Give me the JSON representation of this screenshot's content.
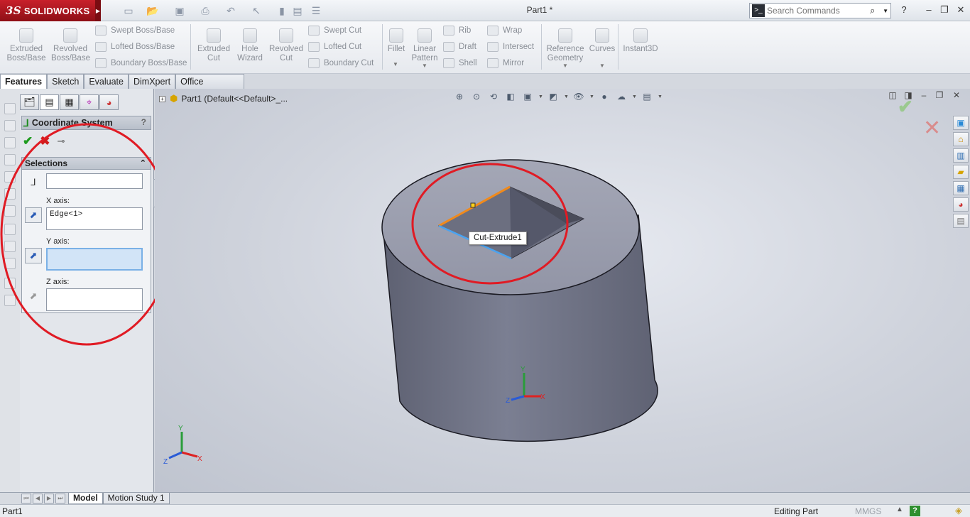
{
  "app": {
    "brand": "SOLIDWORKS",
    "brand_prefix": "3S",
    "document_title": "Part1 *"
  },
  "search": {
    "placeholder": "Search Commands"
  },
  "quick_access": [
    "new-icon",
    "open-icon",
    "save-icon",
    "print-icon",
    "undo-icon",
    "select-icon",
    "rebuild-icon",
    "file-properties-icon",
    "options-icon"
  ],
  "command_manager": {
    "extruded_boss": "Extruded Boss/Base",
    "revolved_boss": "Revolved Boss/Base",
    "swept_boss": "Swept Boss/Base",
    "lofted_boss": "Lofted Boss/Base",
    "boundary_boss": "Boundary Boss/Base",
    "extruded_cut": "Extruded Cut",
    "hole_wizard": "Hole Wizard",
    "revolved_cut": "Revolved Cut",
    "swept_cut": "Swept Cut",
    "lofted_cut": "Lofted Cut",
    "boundary_cut": "Boundary Cut",
    "fillet": "Fillet",
    "linear_pattern": "Linear Pattern",
    "rib": "Rib",
    "draft": "Draft",
    "shell": "Shell",
    "wrap": "Wrap",
    "intersect": "Intersect",
    "mirror": "Mirror",
    "reference_geometry": "Reference Geometry",
    "curves": "Curves",
    "instant3d": "Instant3D"
  },
  "tabs": [
    "Features",
    "Sketch",
    "Evaluate",
    "DimXpert",
    "Office Products"
  ],
  "property_manager": {
    "title": "Coordinate System",
    "help": "?",
    "selections_label": "Selections",
    "origin_value": "",
    "x_axis_label": "X axis:",
    "x_axis_value": "Edge<1>",
    "y_axis_label": "Y axis:",
    "y_axis_value": "",
    "z_axis_label": "Z axis:",
    "z_axis_value": ""
  },
  "feature_tree": {
    "root": "Part1  (Default<<Default>_..."
  },
  "tooltip": "Cut-Extrude1",
  "triad": {
    "x": "X",
    "y": "Y",
    "z": "Z"
  },
  "bottom_tabs": [
    "Model",
    "Motion Study 1"
  ],
  "status": {
    "left": "Part1",
    "mode": "Editing Part",
    "units": "MMGS",
    "help": "?"
  },
  "colors": {
    "annotation_ring": "#e01b24",
    "selected_edge": "#f08a1c",
    "highlight_edge": "#4aa3f0",
    "brand_red": "#b81820"
  }
}
